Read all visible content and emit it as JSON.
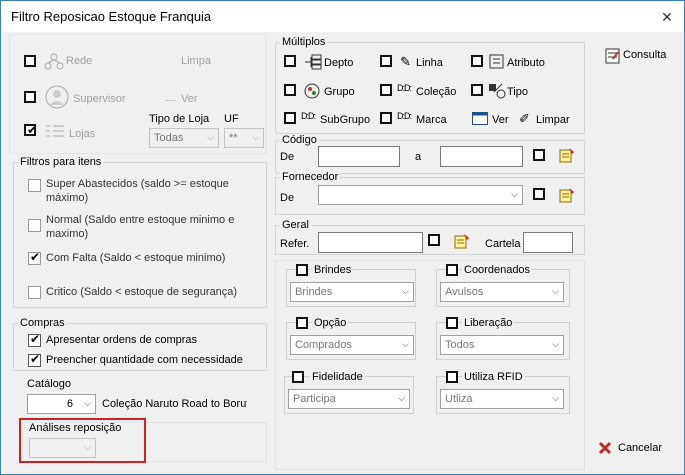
{
  "window": {
    "title": "Filtro Reposicao Estoque Franquia",
    "close": "✕"
  },
  "left": {
    "rede": "Rede",
    "limpa": "Limpa",
    "supervisor": "Supervisor",
    "ver": "Ver",
    "lojas": "Lojas",
    "tipo_loja_label": "Tipo de Loja",
    "tipo_loja_value": "Todas",
    "uf_label": "UF",
    "uf_value": "**"
  },
  "filtros": {
    "title": "Filtros para itens",
    "items": [
      {
        "line1": "Super Abastecidos  (saldo >= estoque",
        "line2": "máximo)",
        "checked": false
      },
      {
        "line1": "Normal (Saldo entre estoque minimo e",
        "line2": "maximo)",
        "checked": false
      },
      {
        "line1": "Com Falta (Saldo < estoque minimo)",
        "line2": "",
        "checked": true
      },
      {
        "line1": "Critico (Saldo < estoque de segurança)",
        "line2": "",
        "checked": false
      }
    ]
  },
  "compras": {
    "title": "Compras",
    "items": [
      {
        "label": "Apresentar ordens de compras",
        "checked": true
      },
      {
        "label": "Preencher quantidade com necessidade",
        "checked": true
      }
    ]
  },
  "catalogo": {
    "label": "Catálogo",
    "number": "6",
    "description": "Coleção Naruto Road to Boruto"
  },
  "analises": {
    "label": "Análises reposição",
    "value": ""
  },
  "multiplos": {
    "title": "Múltiplos",
    "row1": [
      "Depto",
      "Linha",
      "Atributo"
    ],
    "row2": [
      "Grupo",
      "Coleção",
      "Tipo"
    ],
    "row3": [
      "SubGrupo",
      "Marca",
      "Ver",
      "Limpar"
    ]
  },
  "codigo": {
    "title": "Código",
    "de": "De",
    "a": "a"
  },
  "fornecedor": {
    "title": "Fornecedor",
    "de": "De"
  },
  "geral": {
    "title": "Geral",
    "refer": "Refer.",
    "cartela": "Cartela"
  },
  "options": [
    {
      "label": "Brindes",
      "value": "Brindes"
    },
    {
      "label": "Coordenados",
      "value": "Avulsos"
    },
    {
      "label": "Opção",
      "value": "Comprados"
    },
    {
      "label": "Liberação",
      "value": "Todos"
    },
    {
      "label": "Fidelidade",
      "value": "Participa"
    },
    {
      "label": "Utiliza RFID",
      "value": "Utliza"
    }
  ],
  "buttons": {
    "consulta": "Consulta",
    "cancelar": "Cancelar"
  },
  "colors": {
    "accent": "#3c7fb1",
    "highlight": "#d0202a",
    "cancel_x": "#c62828"
  }
}
